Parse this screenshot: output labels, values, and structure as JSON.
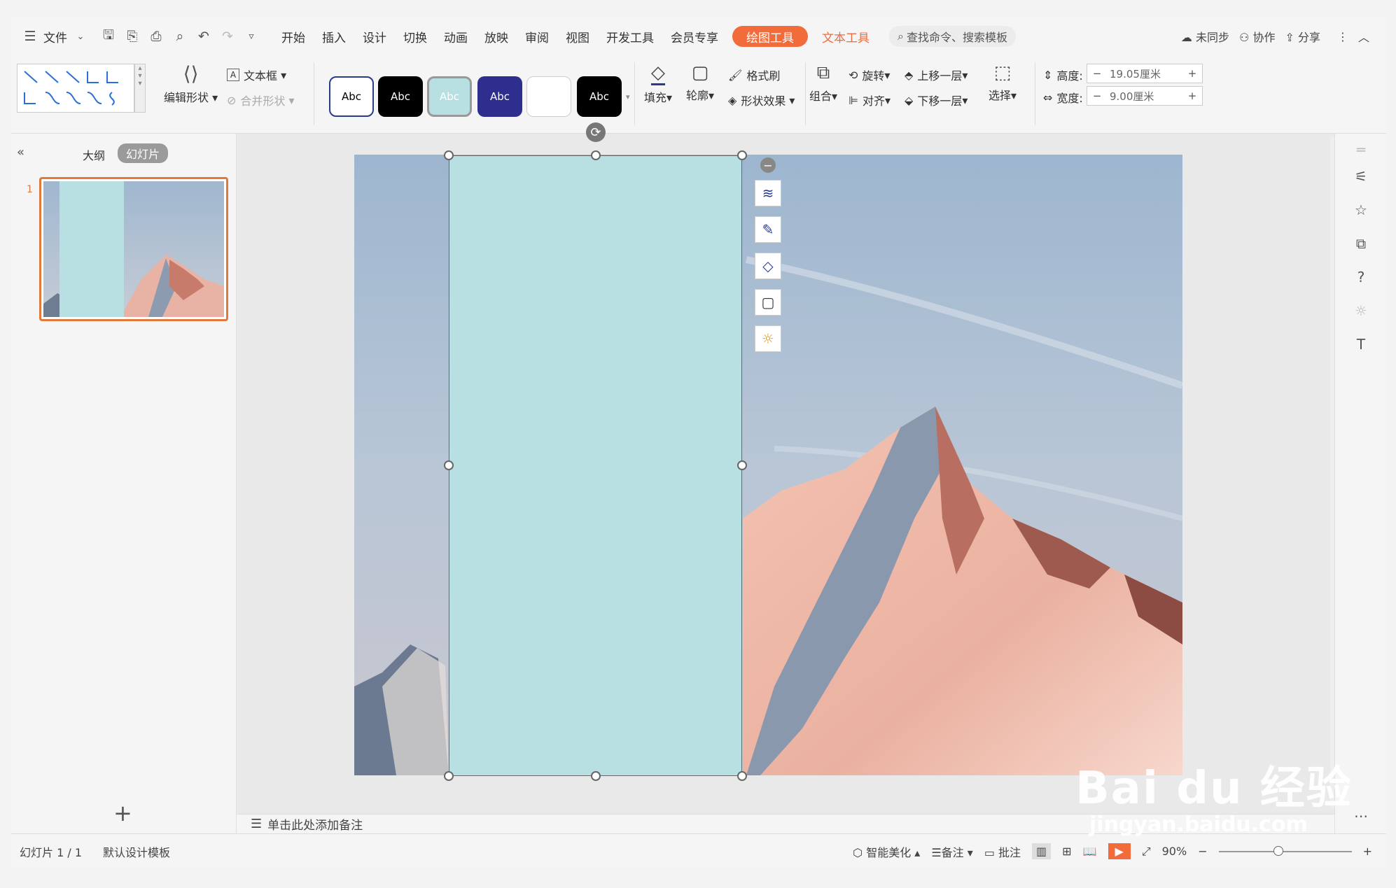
{
  "menubar": {
    "file_label": "文件",
    "tabs": [
      "开始",
      "插入",
      "设计",
      "切换",
      "动画",
      "放映",
      "审阅",
      "视图",
      "开发工具",
      "会员专享"
    ],
    "active_tab": "绘图工具",
    "text_tool_tab": "文本工具",
    "search_placeholder": "查找命令、搜索模板",
    "sync_label": "未同步",
    "collab_label": "协作",
    "share_label": "分享"
  },
  "ribbon": {
    "edit_shape": "编辑形状",
    "text_box": "文本框",
    "merge_shape": "合并形状",
    "style_labels": [
      "Abc",
      "Abc",
      "Abc",
      "Abc",
      "",
      "Abc"
    ],
    "fill": "填充",
    "outline": "轮廓",
    "format_painter": "格式刷",
    "shape_effect": "形状效果",
    "group": "组合",
    "rotate": "旋转",
    "align": "对齐",
    "bring_forward": "上移一层",
    "send_backward": "下移一层",
    "select": "选择",
    "height_label": "高度:",
    "height_value": "19.05厘米",
    "width_label": "宽度:",
    "width_value": "9.00厘米",
    "minus": "−",
    "plus": "+"
  },
  "left_panel": {
    "outline_tab": "大纲",
    "slides_tab": "幻灯片",
    "slide_number": "1",
    "add_label": "+"
  },
  "notes": {
    "placeholder": "单击此处添加备注"
  },
  "statusbar": {
    "slide_count": "幻灯片 1 / 1",
    "template": "默认设计模板",
    "smart_beautify": "智能美化",
    "notes": "备注",
    "comments": "批注",
    "zoom": "90%"
  },
  "watermark": {
    "brand": "Bai du 经验",
    "url": "jingyan.baidu.com"
  },
  "colors": {
    "accent": "#f26b3a",
    "shape_fill": "#b8dfe2",
    "selection_border": "#e07a3c"
  }
}
